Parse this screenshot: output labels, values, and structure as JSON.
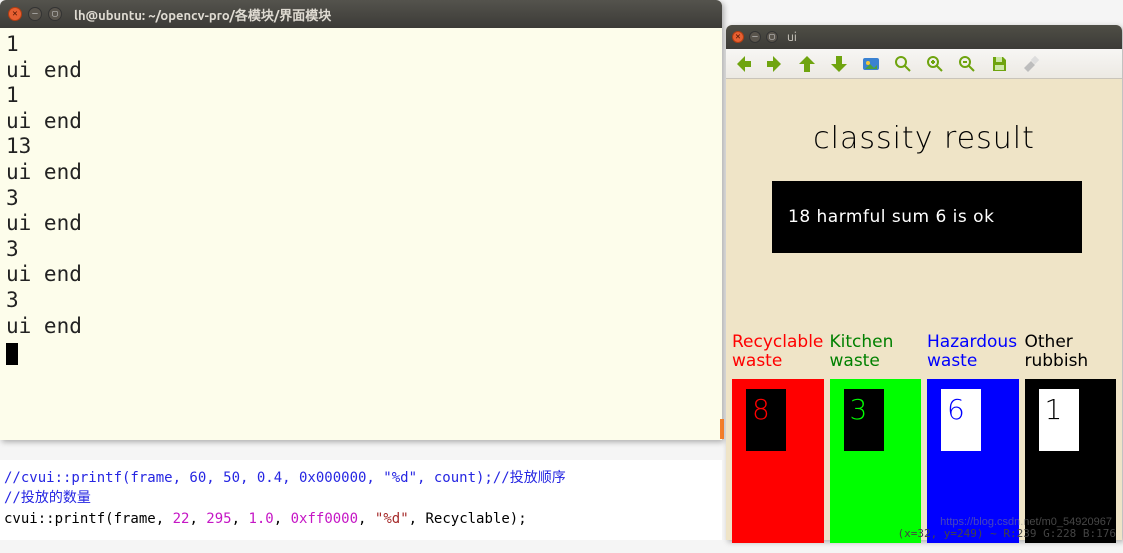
{
  "terminal": {
    "title": "lh@ubuntu: ~/opencv-pro/各模块/界面模块",
    "lines": [
      "1",
      "ui end",
      "1",
      "ui end",
      "13",
      "ui end",
      "3",
      "ui end",
      "3",
      "ui end",
      "3",
      "ui end"
    ]
  },
  "code": {
    "line1_comment": "//cvui::printf(frame, 60, 50, 0.4, 0x000000, \"%d\", count);//投放顺序",
    "line2_comment": "//投放的数量",
    "line3_pre": "cvui::printf(frame, ",
    "line3_n1": "22",
    "line3_sep1": ", ",
    "line3_n2": "295",
    "line3_sep2": ", ",
    "line3_n3": "1.0",
    "line3_sep3": ", ",
    "line3_n4": "0xff0000",
    "line3_sep4": ", ",
    "line3_str": "\"%d\"",
    "line3_post": ", Recyclable);"
  },
  "ui": {
    "title": "ui",
    "heading": "classity result",
    "panel_text": "18  harmful  sum 6  is ok",
    "categories": [
      {
        "label": "Recyclable\nwaste",
        "label_color": "#ff0000",
        "block_color": "#ff0000",
        "inner_bg": "#000000",
        "digit": "8",
        "digit_color": "#ff0000"
      },
      {
        "label": "Kitchen\nwaste",
        "label_color": "#008000",
        "block_color": "#00ff00",
        "inner_bg": "#000000",
        "digit": "3",
        "digit_color": "#00ff00"
      },
      {
        "label": "Hazardous\nwaste",
        "label_color": "#0000ff",
        "block_color": "#0000ff",
        "inner_bg": "#ffffff",
        "digit": "6",
        "digit_color": "#0000ff"
      },
      {
        "label": "Other\nrubbish",
        "label_color": "#000000",
        "block_color": "#000000",
        "inner_bg": "#ffffff",
        "digit": "1",
        "digit_color": "#000000"
      }
    ],
    "status": "(x=32, y=249) ~ R:239 G:228 B:176",
    "watermark": "https://blog.csdn.net/m0_54920967"
  }
}
